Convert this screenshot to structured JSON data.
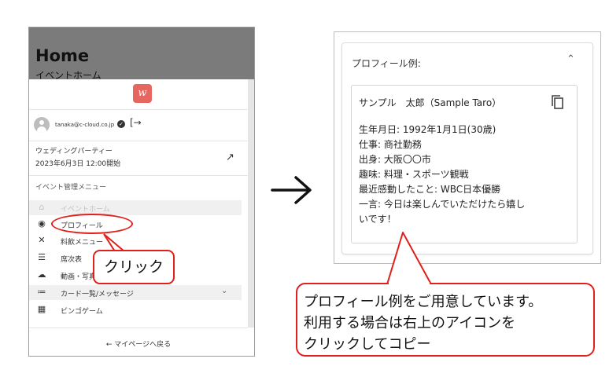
{
  "phone": {
    "home_title": "Home",
    "home_subtitle": "イベントホーム",
    "logo_letter": "w",
    "logo_color": "#e5675f",
    "user_email": "tanaka@c-cloud.co.jp",
    "verified_icon": "verified-check-icon",
    "logout_icon": "logout-icon",
    "event_name": "ウェディングパーティー",
    "event_datetime": "2023年6月3日 12:00開始",
    "event_link_icon": "arrow-up-right-icon",
    "menu_heading": "イベント管理メニュー",
    "menu_items": [
      {
        "label": "イベントホーム",
        "icon": "home-icon",
        "state": "disabled"
      },
      {
        "label": "プロフィール",
        "icon": "heart-pin-icon",
        "state": "normal"
      },
      {
        "label": "料飲メニュー",
        "icon": "utensils-icon",
        "state": "normal"
      },
      {
        "label": "席次表",
        "icon": "seat-icon",
        "state": "normal"
      },
      {
        "label": "動画・写真",
        "icon": "cloud-upload-icon",
        "state": "normal"
      },
      {
        "label": "カード一覧/メッセージ",
        "icon": "list-icon",
        "state": "expandable"
      },
      {
        "label": "ビンゴゲーム",
        "icon": "grid-icon",
        "state": "normal"
      }
    ],
    "back_link": "← マイページへ戻る"
  },
  "annotation": {
    "click_label": "クリック",
    "accent_color": "#e0201a"
  },
  "profile_card": {
    "accordion_title": "プロフィール例:",
    "accordion_icon": "chevron-up-icon",
    "copy_icon": "copy-icon",
    "name_line": "サンプル　太郎（Sample Taro）",
    "lines": [
      "生年月日: 1992年1月1日(30歳)",
      "仕事: 商社勤務",
      "出身: 大阪〇〇市",
      "趣味: 料理・スポーツ観戦",
      "最近感動したこと: WBC日本優勝",
      "一言: 今日は楽しんでいただけたら嬉し",
      "いです！"
    ]
  },
  "callout": {
    "lines": [
      "プロフィール例をご用意しています。",
      "利用する場合は右上のアイコンを",
      "クリックしてコピー"
    ]
  }
}
